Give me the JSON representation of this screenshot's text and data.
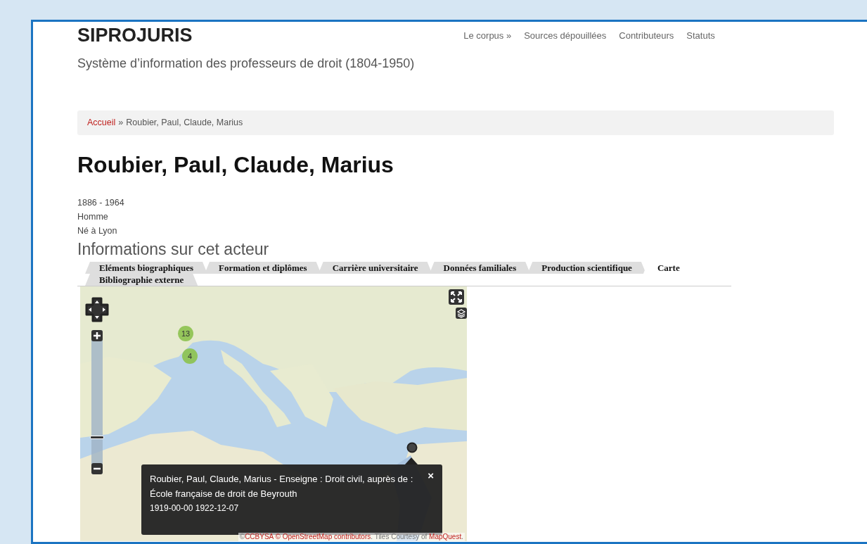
{
  "site": {
    "title": "SIPROJURIS",
    "subtitle": "Système d’information des professeurs de droit (1804-1950)"
  },
  "nav": [
    {
      "label": "Le corpus »"
    },
    {
      "label": "Sources dépouillées"
    },
    {
      "label": "Contributeurs"
    },
    {
      "label": "Statuts"
    }
  ],
  "breadcrumb": {
    "items": [
      {
        "label": "Accueil",
        "kind": "link"
      },
      {
        "label": "Roubier, Paul, Claude, Marius",
        "kind": "current"
      }
    ],
    "separator": "»"
  },
  "heading": "Roubier, Paul, Claude, Marius",
  "facts": [
    "1886 - 1964",
    "Homme",
    "Né à Lyon"
  ],
  "section_title": "Informations sur cet acteur",
  "tabs": [
    {
      "label": "Eléments biographiques",
      "selected": false
    },
    {
      "label": "Formation et diplômes",
      "selected": false
    },
    {
      "label": "Carrière universitaire",
      "selected": false
    },
    {
      "label": "Données familiales",
      "selected": false
    },
    {
      "label": "Production scientifique",
      "selected": false
    },
    {
      "label": "Carte",
      "selected": true
    },
    {
      "label": "Bibliographie externe",
      "selected": false
    }
  ],
  "map": {
    "zoom": {
      "level": 0.2
    },
    "clusters": [
      {
        "label": "13"
      },
      {
        "label": "4"
      }
    ],
    "popup": {
      "text": "Roubier, Paul, Claude, Marius - Enseigne : Droit civil, auprès de : École française de droit de Beyrouth",
      "dates": "1919-00-00 1922-12-07",
      "close": "×"
    },
    "attribution": [
      {
        "text": "©",
        "kind": "text"
      },
      {
        "text": "CCBYSA © OpenStreetMap contributors",
        "kind": "link"
      },
      {
        "text": ". Tiles Courtesy of ",
        "kind": "text"
      },
      {
        "text": "MapQuest",
        "kind": "link"
      },
      {
        "text": ".",
        "kind": "text"
      }
    ]
  }
}
